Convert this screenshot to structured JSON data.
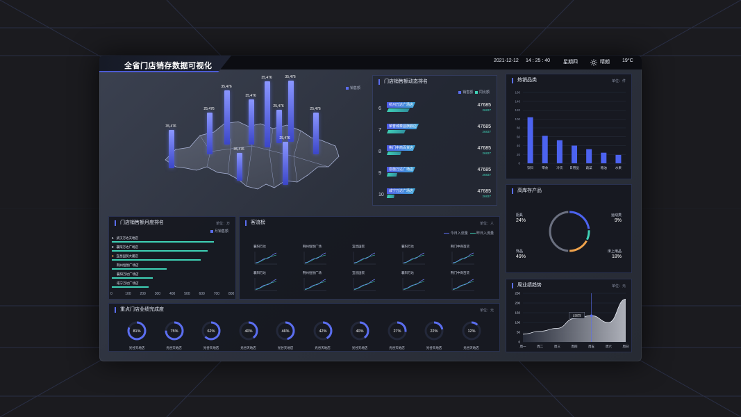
{
  "header": {
    "title": "全省门店销存数据可视化",
    "date": "2021-12-12",
    "time": "14 : 25 : 40",
    "weekday": "星期四",
    "weather": "晴朗",
    "temperature": "19°C"
  },
  "map": {
    "legend": "销售额",
    "bars": [
      {
        "label": "35,476",
        "value": 0.55
      },
      {
        "label": "25,476",
        "value": 0.6
      },
      {
        "label": "35,476",
        "value": 0.78
      },
      {
        "label": "35,476",
        "value": 0.4
      },
      {
        "label": "35,476",
        "value": 0.65
      },
      {
        "label": "35,476",
        "value": 0.95
      },
      {
        "label": "25,476",
        "value": 0.48
      },
      {
        "label": "35,476",
        "value": 0.88
      },
      {
        "label": "25,476",
        "value": 0.62
      },
      {
        "label": "25,476",
        "value": 0.6
      }
    ]
  },
  "ranking": {
    "title": "门店销售额动态排名",
    "legend_a": "销售额",
    "legend_b": "同比额",
    "rows": [
      {
        "no": "6",
        "name": "杭州万达广场店",
        "v1": "47685",
        "v2": "26837",
        "bar": 0.55
      },
      {
        "no": "7",
        "name": "荣誉城泰昌旗舰店",
        "v1": "47685",
        "v2": "26837",
        "bar": 0.45
      },
      {
        "no": "8",
        "name": "荆门中商百货店",
        "v1": "47685",
        "v2": "26837",
        "bar": 0.35
      },
      {
        "no": "9",
        "name": "恩施万达广场店",
        "v1": "47685",
        "v2": "26837",
        "bar": 0.25
      },
      {
        "no": "10",
        "name": "咸宁万达广场店",
        "v1": "47685",
        "v2": "26837",
        "bar": 0.18
      }
    ]
  },
  "hot_products": {
    "title": "热销品类",
    "unit": "单位：件",
    "chart_data": {
      "type": "bar",
      "categories": [
        "饮料",
        "零食",
        "冷饮",
        "日用品",
        "蔬菜",
        "粮油",
        "水果"
      ],
      "values": [
        104,
        62,
        52,
        40,
        32,
        24,
        19
      ],
      "ylim": [
        0,
        160
      ],
      "yticks": [
        "160",
        "140",
        "120",
        "100",
        "80",
        "60",
        "40",
        "20",
        "0"
      ]
    }
  },
  "high_stock": {
    "title": "高库存产品",
    "items": [
      {
        "name": "厨具",
        "pct": "24%",
        "color": "#4c63f0",
        "share": 0.24
      },
      {
        "name": "运动类",
        "pct": "9%",
        "color": "#3fd1b6",
        "share": 0.09
      },
      {
        "name": "床上用品",
        "pct": "18%",
        "color": "#f0a34c",
        "share": 0.18
      },
      {
        "name": "饰品",
        "pct": "49%",
        "color": "#6b7080",
        "share": 0.49
      }
    ]
  },
  "monthly_rank": {
    "title": "门店销售额月度排名",
    "unit": "单位：万",
    "legend": "月销售额",
    "rows": [
      {
        "no": "1",
        "name": "武汉万达天地店",
        "value": 690
      },
      {
        "no": "2",
        "name": "襄阳万达广场店",
        "value": 650
      },
      {
        "no": "3",
        "name": "宜昌国贸大厦店",
        "value": 600
      },
      {
        "no": "",
        "name": "荆州恒悦广场店",
        "value": 370
      },
      {
        "no": "",
        "name": "襄阳万达广场店",
        "value": 280
      },
      {
        "no": "",
        "name": "咸宁万达广场店",
        "value": 250
      }
    ],
    "xticks": [
      "0",
      "100",
      "200",
      "300",
      "400",
      "500",
      "600",
      "700",
      "800"
    ]
  },
  "flow": {
    "title": "客流榜",
    "unit": "单位：人",
    "legend_a": "今日入流量",
    "legend_b": "昨日入流量",
    "cells": [
      "襄阳万达",
      "荆州恒悦广场",
      "宜昌国贸",
      "襄阳万达",
      "荆门中商百货",
      "襄阳万达",
      "荆州恒悦广场",
      "宜昌国贸",
      "襄阳万达",
      "荆门中商百货"
    ]
  },
  "completion": {
    "title": "重点门店业绩完成度",
    "unit": "单位：元",
    "items": [
      {
        "pct": "81%",
        "value": 0.81,
        "name": "光谷天地店"
      },
      {
        "pct": "75%",
        "value": 0.75,
        "name": "光谷天地店"
      },
      {
        "pct": "62%",
        "value": 0.62,
        "name": "光谷天地店"
      },
      {
        "pct": "40%",
        "value": 0.4,
        "name": "光谷天地店"
      },
      {
        "pct": "46%",
        "value": 0.46,
        "name": "光谷天地店"
      },
      {
        "pct": "42%",
        "value": 0.42,
        "name": "光谷天地店"
      },
      {
        "pct": "40%",
        "value": 0.4,
        "name": "光谷天地店"
      },
      {
        "pct": "27%",
        "value": 0.27,
        "name": "光谷天地店"
      },
      {
        "pct": "22%",
        "value": 0.22,
        "name": "光谷天地店"
      },
      {
        "pct": "12%",
        "value": 0.12,
        "name": "光谷天地店"
      }
    ]
  },
  "trend": {
    "title": "周业绩趋势",
    "unit": "单位：元",
    "tooltip": "135万",
    "chart_data": {
      "type": "area",
      "categories": [
        "周一",
        "周二",
        "周三",
        "周四",
        "周五",
        "周六",
        "周日"
      ],
      "values": [
        40,
        55,
        70,
        120,
        135,
        100,
        220
      ],
      "ylim": [
        0,
        250
      ],
      "yticks": [
        "250",
        "200",
        "150",
        "100",
        "50",
        "0"
      ]
    }
  },
  "colors": {
    "accent": "#5b6ef0",
    "teal": "#3fd1b6",
    "orange": "#f0a34c"
  }
}
